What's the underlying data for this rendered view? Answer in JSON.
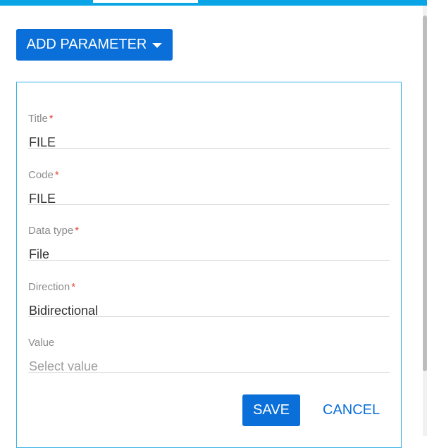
{
  "toolbar": {
    "add_parameter_label": "ADD PARAMETER"
  },
  "form": {
    "fields": [
      {
        "label": "Title",
        "required": true,
        "value": "FILE"
      },
      {
        "label": "Code",
        "required": true,
        "value": "FILE"
      },
      {
        "label": "Data type",
        "required": true,
        "value": "File"
      },
      {
        "label": "Direction",
        "required": true,
        "value": "Bidirectional"
      },
      {
        "label": "Value",
        "required": false,
        "placeholder": "Select value"
      }
    ],
    "save_label": "SAVE",
    "cancel_label": "CANCEL"
  },
  "colors": {
    "accent": "#0a6fd8",
    "top_bar": "#0aa5e6",
    "required_mark": "#e0473a",
    "panel_border": "#37b0e6"
  }
}
